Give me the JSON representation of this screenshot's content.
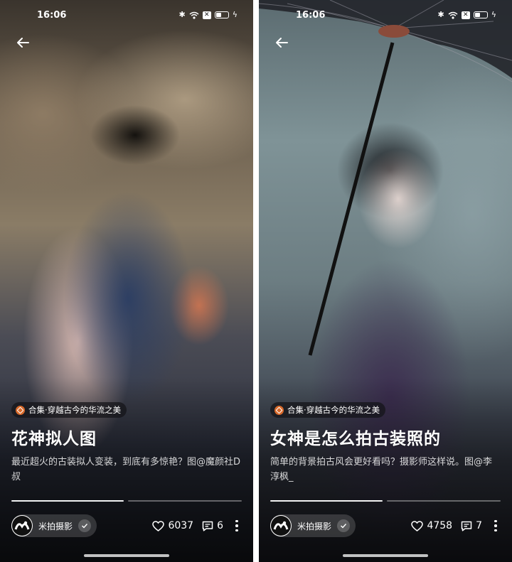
{
  "screens": [
    {
      "status_time": "16:06",
      "badge_text": "合集·穿越古今的华流之美",
      "title": "花神拟人图",
      "description": "最近超火的古装拟人变装，到底有多惊艳？图@魔颜社D叔",
      "author_name": "米拍摄影",
      "likes": "6037",
      "comments": "6"
    },
    {
      "status_time": "16:06",
      "badge_text": "合集·穿越古今的华流之美",
      "title": "女神是怎么拍古装照的",
      "description": "简单的背景拍古风会更好看吗？摄影师这样说。图@李淳枫_",
      "author_name": "米拍摄影",
      "likes": "4758",
      "comments": "7"
    }
  ],
  "colors": {
    "badge_accent": "#d86a2b",
    "text": "#ffffff"
  },
  "icons": [
    "back-arrow-icon",
    "bluetooth-icon",
    "wifi-icon",
    "sim-x-icon",
    "battery-icon",
    "charging-bolt-icon",
    "collection-badge-icon",
    "check-icon",
    "heart-icon",
    "comment-icon",
    "more-vertical-icon"
  ]
}
